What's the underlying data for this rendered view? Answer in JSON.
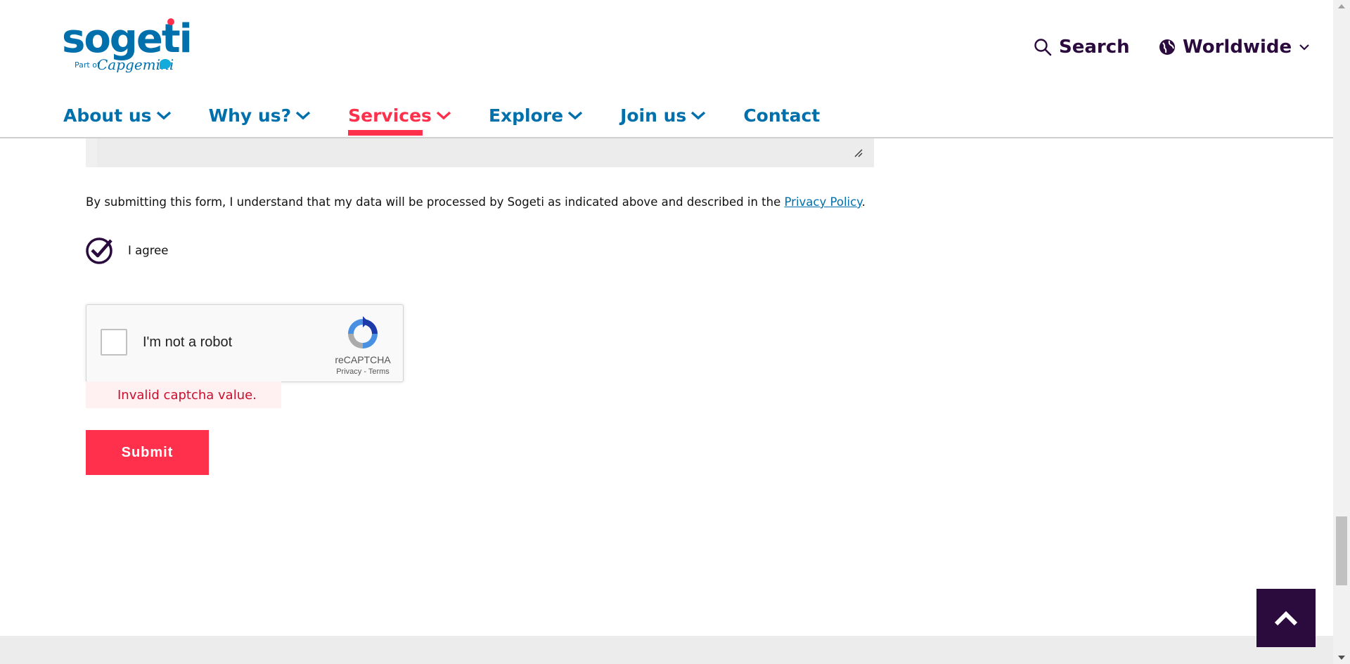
{
  "header": {
    "logo_text": "sogeti",
    "logo_part_of": "Part of",
    "logo_parent": "Capgemini",
    "search_label": "Search",
    "region_label": "Worldwide"
  },
  "nav": {
    "items": [
      {
        "label": "About us",
        "has_dropdown": true,
        "active": false
      },
      {
        "label": "Why us?",
        "has_dropdown": true,
        "active": false
      },
      {
        "label": "Services",
        "has_dropdown": true,
        "active": true
      },
      {
        "label": "Explore",
        "has_dropdown": true,
        "active": false
      },
      {
        "label": "Join us",
        "has_dropdown": true,
        "active": false
      },
      {
        "label": "Contact",
        "has_dropdown": false,
        "active": false
      }
    ]
  },
  "form": {
    "consent_text": "By submitting this form, I understand that my data will be processed by Sogeti as indicated above and described in the ",
    "privacy_link": "Privacy Policy",
    "consent_end": ".",
    "agree_label": "I agree",
    "agree_checked": true,
    "recaptcha": {
      "label": "I'm not a robot",
      "brand": "reCAPTCHA",
      "privacy": "Privacy",
      "separator": " - ",
      "terms": "Terms"
    },
    "captcha_error": "Invalid captcha value.",
    "submit_label": "Submit"
  },
  "colors": {
    "brand_blue": "#0070ad",
    "brand_red": "#ff304c",
    "dark_purple": "#2b0a3d"
  },
  "icons": {
    "search": "search-icon",
    "globe": "globe-icon",
    "chevron": "chevron-down-icon",
    "check": "check-circle-icon",
    "back_to_top": "arrow-up-icon"
  }
}
